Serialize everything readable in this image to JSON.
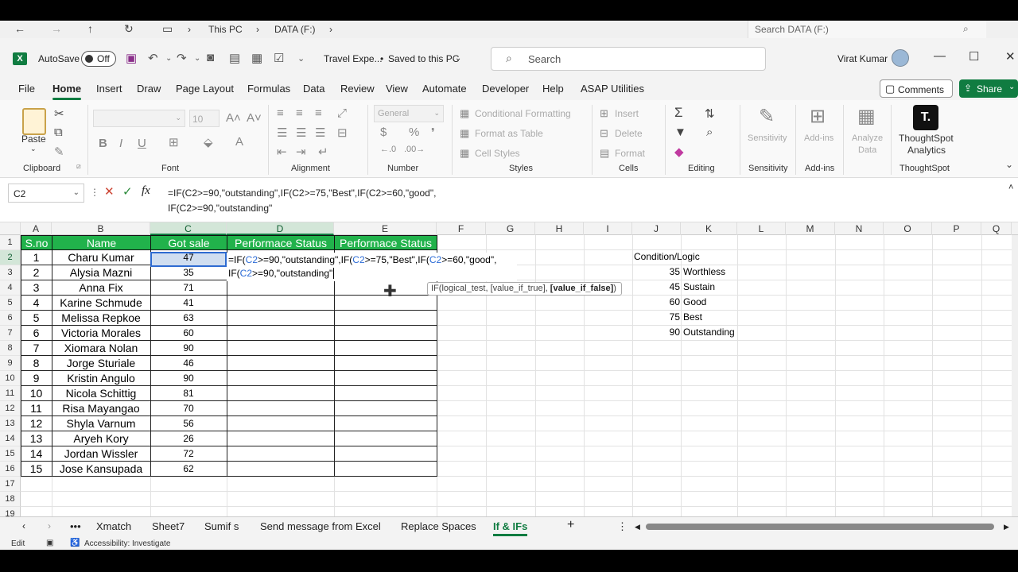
{
  "explorer": {
    "breadcrumb": [
      "This PC",
      "DATA (F:)"
    ],
    "search_placeholder": "Search DATA (F:)"
  },
  "titlebar": {
    "autosave_label": "AutoSave",
    "autosave_state": "Off",
    "doc_name": "Travel Expe...",
    "save_status": "Saved to this PC",
    "search_placeholder": "Search",
    "user_name": "Virat Kumar"
  },
  "ribbon_tabs": [
    "File",
    "Home",
    "Insert",
    "Draw",
    "Page Layout",
    "Formulas",
    "Data",
    "Review",
    "View",
    "Automate",
    "Developer",
    "Help",
    "ASAP Utilities"
  ],
  "active_tab": "Home",
  "comments_label": "Comments",
  "share_label": "Share",
  "ribbon": {
    "clipboard": {
      "group": "Clipboard",
      "paste": "Paste"
    },
    "font": {
      "group": "Font",
      "size": "10"
    },
    "alignment": {
      "group": "Alignment"
    },
    "number": {
      "group": "Number",
      "format": "General"
    },
    "styles": {
      "group": "Styles",
      "conditional": "Conditional Formatting",
      "format_table": "Format as Table",
      "cell_styles": "Cell Styles"
    },
    "cells": {
      "group": "Cells",
      "insert": "Insert",
      "delete": "Delete",
      "format": "Format"
    },
    "editing": {
      "group": "Editing"
    },
    "sensitivity": {
      "group": "Sensitivity",
      "label": "Sensitivity"
    },
    "addins": {
      "group": "Add-ins",
      "label": "Add-ins"
    },
    "analyze": {
      "label1": "Analyze",
      "label2": "Data"
    },
    "thoughtspot": {
      "group": "ThoughtSpot",
      "label1": "ThoughtSpot",
      "label2": "Analytics"
    }
  },
  "formula_bar": {
    "name_box": "C2",
    "line1": "=IF(C2>=90,\"outstanding\",IF(C2>=75,\"Best\",IF(C2>=60,\"good\",",
    "line2": "IF(C2>=90,\"outstanding\""
  },
  "columns": [
    "A",
    "B",
    "C",
    "D",
    "E",
    "F",
    "G",
    "H",
    "I",
    "J",
    "K",
    "L",
    "M",
    "N",
    "O",
    "P",
    "Q"
  ],
  "rows": [
    "1",
    "2",
    "3",
    "4",
    "5",
    "6",
    "7",
    "8",
    "9",
    "10",
    "11",
    "12",
    "13",
    "14",
    "15",
    "16",
    "17",
    "18",
    "19"
  ],
  "headers": {
    "sno": "S.no",
    "name": "Name",
    "sale": "Got sale",
    "status1": "Performace Status",
    "status2": "Performace Status"
  },
  "table_rows": [
    {
      "sno": "1",
      "name": "Charu Kumar",
      "sale": "47"
    },
    {
      "sno": "2",
      "name": "Alysia Mazni",
      "sale": "35"
    },
    {
      "sno": "3",
      "name": "Anna Fix",
      "sale": "71"
    },
    {
      "sno": "4",
      "name": "Karine Schmude",
      "sale": "41"
    },
    {
      "sno": "5",
      "name": "Melissa Repkoe",
      "sale": "63"
    },
    {
      "sno": "6",
      "name": "Victoria Morales",
      "sale": "60"
    },
    {
      "sno": "7",
      "name": "Xiomara Nolan",
      "sale": "90"
    },
    {
      "sno": "8",
      "name": "Jorge Sturiale",
      "sale": "46"
    },
    {
      "sno": "9",
      "name": "Kristin Angulo",
      "sale": "90"
    },
    {
      "sno": "10",
      "name": "Nicola Schittig",
      "sale": "81"
    },
    {
      "sno": "11",
      "name": "Risa Mayangao",
      "sale": "70"
    },
    {
      "sno": "12",
      "name": "Shyla Varnum",
      "sale": "56"
    },
    {
      "sno": "13",
      "name": "Aryeh Kory",
      "sale": "26"
    },
    {
      "sno": "14",
      "name": "Jordan Wissler",
      "sale": "72"
    },
    {
      "sno": "15",
      "name": "Jose Kansupada",
      "sale": "62"
    }
  ],
  "editor": {
    "l1_a": "=IF(",
    "l1_b": "C2",
    "l1_c": ">=90,\"outstanding\",IF(",
    "l1_d": "C2",
    "l1_e": ">=75,\"Best\",IF(",
    "l1_f": "C2",
    "l1_g": ">=60,\"good\",",
    "l2_a": "IF(",
    "l2_b": "C2",
    "l2_c": ">=90,\"outstanding\""
  },
  "tooltip": {
    "text": "IF(logical_test, [value_if_true], ",
    "bold": "[value_if_false]",
    "end": ")"
  },
  "condition": {
    "title": "Condition/Logic",
    "items": [
      {
        "value": "35",
        "label": "Worthless"
      },
      {
        "value": "45",
        "label": "Sustain"
      },
      {
        "value": "60",
        "label": "Good"
      },
      {
        "value": "75",
        "label": "Best"
      },
      {
        "value": "90",
        "label": "Outstanding"
      }
    ]
  },
  "sheet_tabs": [
    "Xmatch",
    "Sheet7",
    "Sumif s",
    "Send message from Excel",
    "Replace Spaces",
    "If & IFs"
  ],
  "active_sheet": "If & IFs",
  "status": {
    "mode": "Edit",
    "accessibility": "Accessibility: Investigate"
  }
}
